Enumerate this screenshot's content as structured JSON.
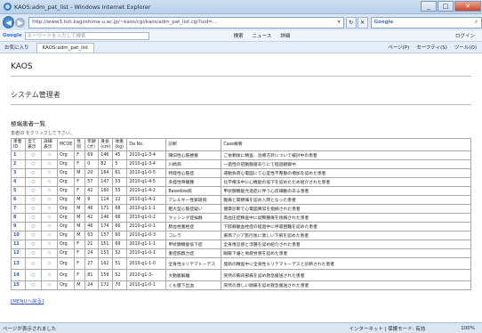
{
  "window": {
    "title": "KAOS:adm_pat_list - Windows Internet Explorer",
    "url": "http://www3.tuh.kagoshima-u.ac.jp/~kaos/cgi/kaos/adm_pat_list.cgi?uid=...",
    "search_engine": "Google"
  },
  "google_bar": {
    "label": "Google",
    "search_placeholder": "キーワードを入力して検索",
    "items": [
      "検索",
      "ニュース",
      "詳細"
    ],
    "login": "ログイン"
  },
  "favorites_bar": {
    "favorites": "お気に入り",
    "tab": "KAOS:adm_pat_list",
    "tools": [
      "ページ(P)",
      "セーフティ(S)",
      "ツール(O)"
    ]
  },
  "page": {
    "site_title": "KAOS",
    "section": "システム管理者",
    "heading": "極端患者一覧",
    "hint": "患者ID をクリックして下さい。",
    "menu_link": "[MENUへ戻る]"
  },
  "table": {
    "headers": [
      "患者ID",
      "全て表示",
      "詳細表示",
      "MCOE",
      "性別",
      "年齢(才)",
      "身長(cm)",
      "体重(kg)",
      "Da No.",
      "診断",
      "Case概要"
    ],
    "rows": [
      [
        "1",
        "○",
        "☆",
        "Org",
        "F",
        "69",
        "146",
        "45",
        "2010-g1-3-4",
        "陳旧性心筋梗塞",
        "ご依頼後に精査、治療方針について検討中の患者"
      ],
      [
        "2",
        "○",
        "☆",
        "Org",
        "F",
        "0",
        "82",
        "5",
        "2010-g1-3-4",
        "川崎病",
        "一過性の冠動脈瘤ありにて経過観察中"
      ],
      [
        "3",
        "○",
        "☆",
        "Org",
        "M",
        "20",
        "164",
        "61",
        "2010-g1-0-5",
        "特発性心筋症",
        "運動負荷心電図にて心室性不整脈の増加を認めた患者"
      ],
      [
        "4",
        "○",
        "☆",
        "Org",
        "F",
        "57",
        "147",
        "53",
        "2010-g1-4-5",
        "多発性骨髄腫",
        "化学療法中に心機能の低下を認めたため紹介された患者"
      ],
      [
        "5",
        "○",
        "☆",
        "Org",
        "F",
        "42",
        "160",
        "53",
        "2010-g1-4-2",
        "Basedow病",
        "甲状腺機能亢進症に伴う心房細動のある患者"
      ],
      [
        "6",
        "○",
        "☆",
        "Org",
        "M",
        "9",
        "114",
        "22",
        "2010-g1-4-1",
        "アレルギー性紫斑病",
        "腹痛と関節痛を認め入院となった患者"
      ],
      [
        "7",
        "○",
        "☆",
        "Org",
        "M",
        "46",
        "171",
        "68",
        "2010-g1-1-1",
        "肥大型心筋症疑い",
        "健康診断で心電図異常を指摘された患者"
      ],
      [
        "8",
        "○",
        "☆",
        "Org",
        "M",
        "42",
        "146",
        "66",
        "2010-g1-0-2",
        "クッシング症候群",
        "高血圧症精査中に副腎腫瘍を指摘された患者"
      ],
      [
        "9",
        "○",
        "☆",
        "Org",
        "M",
        "46",
        "174",
        "66",
        "2010-g1-0-1",
        "肺血栓塞栓症",
        "下肢静脈血栓症の経過中に呼吸困難を認めた患者"
      ],
      [
        "10",
        "○",
        "☆",
        "Org",
        "M",
        "63",
        "157",
        "60",
        "2010-g1-0-3",
        "コレラ",
        "東南アジア旅行後に激しい下痢を認めた患者"
      ],
      [
        "11",
        "○",
        "☆",
        "Org",
        "F",
        "21",
        "151",
        "69",
        "2010-g1-1-1",
        "甲状腺機能低下症",
        "全身倦怠感と浮腫を認め紹介された患者"
      ],
      [
        "12",
        "○",
        "☆",
        "Org",
        "F",
        "24",
        "153",
        "52",
        "2010-g1-0-1",
        "重症筋無力症",
        "眼瞼下垂と易疲労感を認めた患者"
      ],
      [
        "13",
        "○",
        "☆",
        "Org",
        "F",
        "27",
        "162",
        "51",
        "2010-g1-1-0",
        "全身性エリテマトーデス",
        "発熱の精査中に全身性エリテマトーデスと診断された患者"
      ],
      [
        "14",
        "○",
        "☆",
        "Org",
        "F",
        "81",
        "159",
        "52",
        "2010-g1-3-",
        "大動脈解離",
        "突然の胸背部痛を認め救急搬送された患者"
      ],
      [
        "15",
        "○",
        "☆",
        "Org",
        "M",
        "24",
        "172",
        "70",
        "2010-g1-0-1",
        "くも膜下出血",
        "突然の激しい頭痛を認め救急搬送された患者"
      ]
    ]
  },
  "statusbar": {
    "left": "ページが表示されました",
    "zone": "インターネット | 保護モード: 有効",
    "zoom": "100%"
  }
}
